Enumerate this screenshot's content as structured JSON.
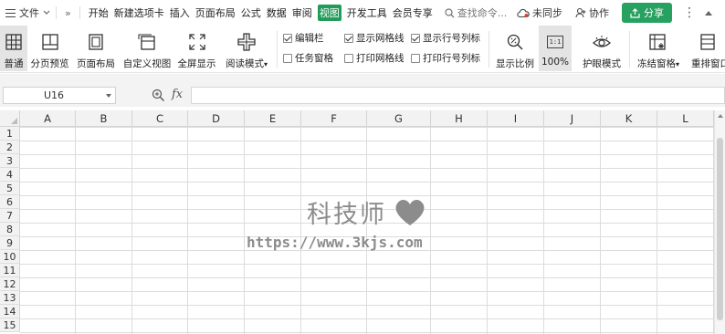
{
  "menubar": {
    "file_label": "文件",
    "more_label": "»",
    "tabs": [
      {
        "label": "开始",
        "active": false
      },
      {
        "label": "新建选项卡",
        "active": false
      },
      {
        "label": "插入",
        "active": false
      },
      {
        "label": "页面布局",
        "active": false
      },
      {
        "label": "公式",
        "active": false
      },
      {
        "label": "数据",
        "active": false
      },
      {
        "label": "审阅",
        "active": false
      },
      {
        "label": "视图",
        "active": true
      },
      {
        "label": "开发工具",
        "active": false
      },
      {
        "label": "会员专享",
        "active": false
      }
    ],
    "search_label": "查找命令...",
    "sync_label": "未同步",
    "collab_label": "协作",
    "share_label": "分享",
    "more_menu": "⋮",
    "accent_color": "#1f9c5a"
  },
  "ribbon": {
    "buttons": [
      {
        "key": "normal",
        "label": "普通",
        "icon": "grid-view-icon",
        "active": true
      },
      {
        "key": "pagebreak",
        "label": "分页预览",
        "icon": "page-break-icon",
        "active": false
      },
      {
        "key": "pagelayout",
        "label": "页面布局",
        "icon": "page-layout-icon",
        "active": false
      },
      {
        "key": "customview",
        "label": "自定义视图",
        "icon": "custom-view-icon",
        "active": false
      },
      {
        "key": "fullscreen",
        "label": "全屏显示",
        "icon": "fullscreen-icon",
        "active": false
      },
      {
        "key": "readmode",
        "label": "阅读模式",
        "icon": "reading-mode-icon",
        "active": false
      }
    ],
    "checkboxes": [
      {
        "label": "编辑栏",
        "checked": true
      },
      {
        "label": "任务窗格",
        "checked": false
      },
      {
        "label": "显示网格线",
        "checked": true
      },
      {
        "label": "打印网格线",
        "checked": false
      },
      {
        "label": "显示行号列标",
        "checked": true
      },
      {
        "label": "打印行号列标",
        "checked": false
      }
    ],
    "zoom_label": "显示比例",
    "zoom100_label": "100%",
    "zoom100_icon_text": "1:1",
    "eyecare_label": "护眼模式",
    "freeze_label": "冻结窗格",
    "rearrange_label": "重排窗口"
  },
  "formula": {
    "cell_ref": "U16",
    "fx_label": "fx",
    "value": ""
  },
  "sheet": {
    "columns": [
      "A",
      "B",
      "C",
      "D",
      "E",
      "F",
      "G",
      "H",
      "I",
      "J",
      "K",
      "L"
    ],
    "rows": [
      "1",
      "2",
      "3",
      "4",
      "5",
      "6",
      "7",
      "8",
      "9",
      "10",
      "11",
      "12",
      "13",
      "14",
      "15"
    ]
  },
  "watermark": {
    "title": "科技师",
    "url": "https://www.3kjs.com"
  }
}
